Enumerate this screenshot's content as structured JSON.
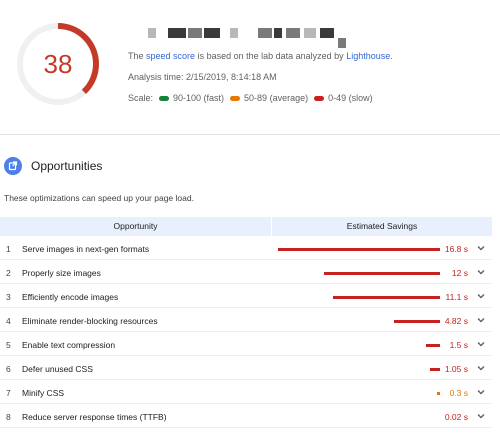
{
  "score": {
    "value": "38",
    "fraction": 0.38,
    "color": "#c53929",
    "track_color": "#f0f0f0"
  },
  "info": {
    "line1_prefix": "The ",
    "line1_link": "speed score",
    "line1_mid": " is based on the lab data analyzed by ",
    "line1_link2": "Lighthouse",
    "line1_suffix": ".",
    "analysis_time": "Analysis time: 2/15/2019, 8:14:18 AM",
    "scale_label": "Scale:",
    "scale": [
      {
        "label": "90-100 (fast)",
        "color": "#178239"
      },
      {
        "label": "50-89 (average)",
        "color": "#e67700"
      },
      {
        "label": "0-49 (slow)",
        "color": "#c7221f"
      }
    ]
  },
  "opportunities": {
    "title": "Opportunities",
    "description": "These optimizations can speed up your page load.",
    "col_opportunity": "Opportunity",
    "col_savings": "Estimated Savings",
    "items": [
      {
        "num": "1",
        "label": "Serve images in next-gen formats",
        "savings": "16.8 s",
        "seconds": 16.8,
        "color": "#c7221f"
      },
      {
        "num": "2",
        "label": "Properly size images",
        "savings": "12 s",
        "seconds": 12,
        "color": "#c7221f"
      },
      {
        "num": "3",
        "label": "Efficiently encode images",
        "savings": "11.1 s",
        "seconds": 11.1,
        "color": "#c7221f"
      },
      {
        "num": "4",
        "label": "Eliminate render-blocking resources",
        "savings": "4.82 s",
        "seconds": 4.82,
        "color": "#c7221f"
      },
      {
        "num": "5",
        "label": "Enable text compression",
        "savings": "1.5 s",
        "seconds": 1.5,
        "color": "#c7221f"
      },
      {
        "num": "6",
        "label": "Defer unused CSS",
        "savings": "1.05 s",
        "seconds": 1.05,
        "color": "#c7221f"
      },
      {
        "num": "7",
        "label": "Minify CSS",
        "savings": "0.3 s",
        "seconds": 0.3,
        "color": "#e67700"
      },
      {
        "num": "8",
        "label": "Reduce server response times (TTFB)",
        "savings": "0.02 s",
        "seconds": 0.02,
        "color": "#c7221f"
      }
    ]
  }
}
